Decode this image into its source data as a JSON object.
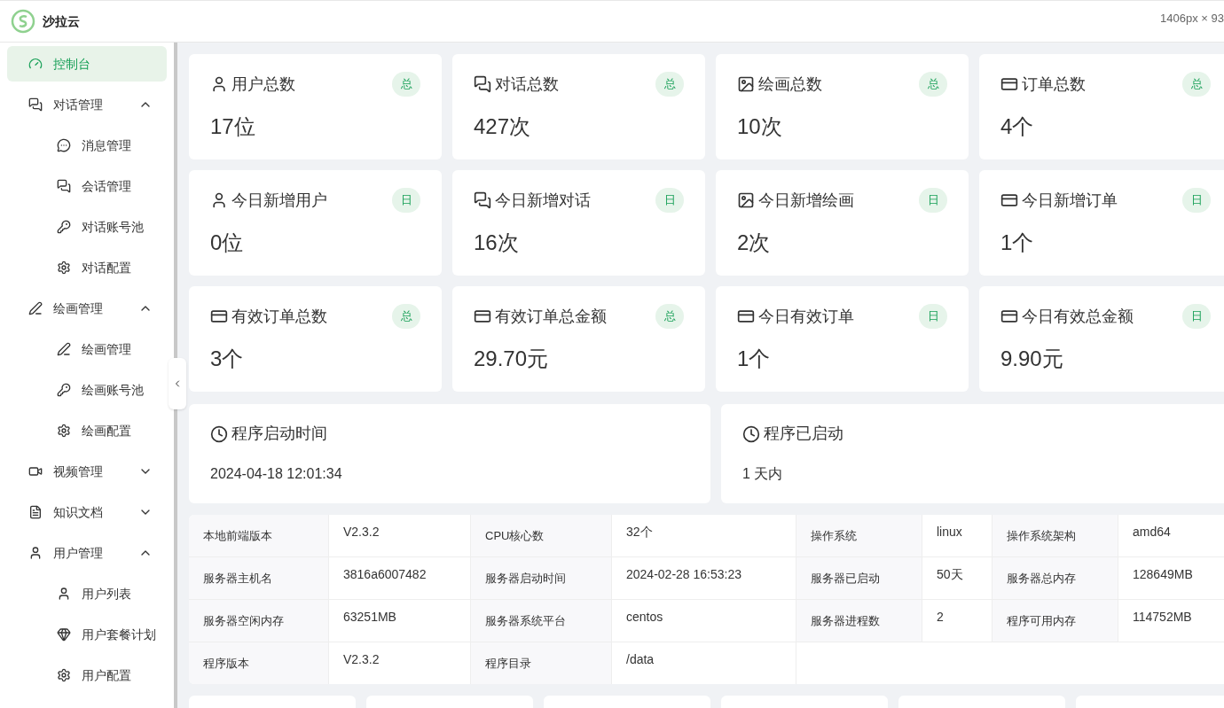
{
  "header": {
    "brand": "沙拉云",
    "overlay_text": "1406px × 93"
  },
  "sidebar": {
    "items": [
      {
        "label": "控制台",
        "selected": true
      },
      {
        "label": "对话管理",
        "selected": false,
        "expanded": true,
        "children": [
          {
            "label": "消息管理",
            "selected": false
          },
          {
            "label": "会话管理",
            "selected": false
          },
          {
            "label": "对话账号池",
            "selected": false
          },
          {
            "label": "对话配置",
            "selected": false
          }
        ]
      },
      {
        "label": "绘画管理",
        "selected": false,
        "expanded": true,
        "children": [
          {
            "label": "绘画管理",
            "selected": false
          },
          {
            "label": "绘画账号池",
            "selected": false
          },
          {
            "label": "绘画配置",
            "selected": false
          }
        ]
      },
      {
        "label": "视频管理",
        "selected": false,
        "expanded": false
      },
      {
        "label": "知识文档",
        "selected": false,
        "expanded": false
      },
      {
        "label": "用户管理",
        "selected": false,
        "expanded": true,
        "children": [
          {
            "label": "用户列表",
            "selected": false
          },
          {
            "label": "用户套餐计划",
            "selected": false
          },
          {
            "label": "用户配置",
            "selected": false
          }
        ]
      }
    ]
  },
  "stats": [
    {
      "title": "用户总数",
      "badge": "总",
      "value": "17位"
    },
    {
      "title": "对话总数",
      "badge": "总",
      "value": "427次"
    },
    {
      "title": "绘画总数",
      "badge": "总",
      "value": "10次"
    },
    {
      "title": "订单总数",
      "badge": "总",
      "value": "4个"
    },
    {
      "title": "今日新增用户",
      "badge": "日",
      "value": "0位"
    },
    {
      "title": "今日新增对话",
      "badge": "日",
      "value": "16次"
    },
    {
      "title": "今日新增绘画",
      "badge": "日",
      "value": "2次"
    },
    {
      "title": "今日新增订单",
      "badge": "日",
      "value": "1个"
    },
    {
      "title": "有效订单总数",
      "badge": "总",
      "value": "3个"
    },
    {
      "title": "有效订单总金额",
      "badge": "总",
      "value": "29.70元"
    },
    {
      "title": "今日有效订单",
      "badge": "日",
      "value": "1个"
    },
    {
      "title": "今日有效总金额",
      "badge": "日",
      "value": "9.90元"
    }
  ],
  "time_cards": [
    {
      "title": "程序启动时间",
      "value": "2024-04-18 12:01:34"
    },
    {
      "title": "程序已启动",
      "value": "1 天内"
    }
  ],
  "info_table": {
    "rows": [
      [
        {
          "label": "本地前端版本",
          "value": "V2.3.2"
        },
        {
          "label": "CPU核心数",
          "value": "32个"
        },
        {
          "label": "操作系统",
          "value": "linux"
        },
        {
          "label": "操作系统架构",
          "value": "amd64"
        }
      ],
      [
        {
          "label": "服务器主机名",
          "value": "3816a6007482"
        },
        {
          "label": "服务器启动时间",
          "value": "2024-02-28 16:53:23"
        },
        {
          "label": "服务器已启动",
          "value": "50天"
        },
        {
          "label": "服务器总内存",
          "value": "128649MB"
        }
      ],
      [
        {
          "label": "服务器空闲内存",
          "value": "63251MB"
        },
        {
          "label": "服务器系统平台",
          "value": "centos"
        },
        {
          "label": "服务器进程数",
          "value": "2"
        },
        {
          "label": "程序可用内存",
          "value": "114752MB"
        }
      ],
      [
        {
          "label": "程序版本",
          "value": "V2.3.2"
        },
        {
          "label": "程序目录",
          "value": "/data"
        }
      ]
    ]
  }
}
